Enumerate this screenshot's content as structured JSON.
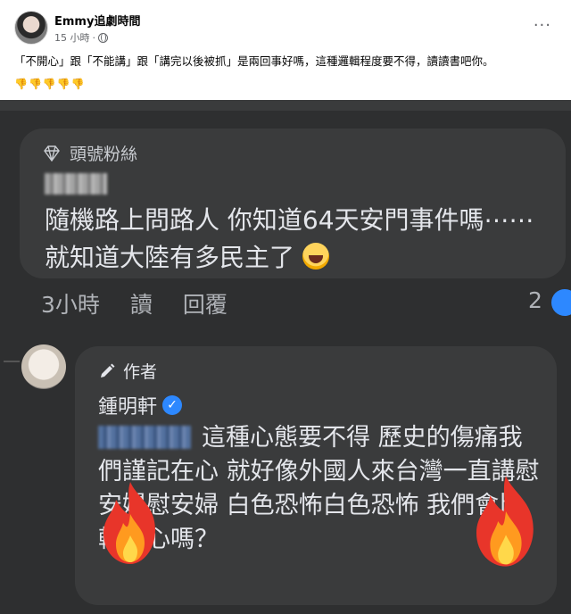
{
  "post": {
    "author": "Emmy追劇時間",
    "time": "15 小時",
    "separator": "·",
    "text": "「不開心」跟「不能講」跟「講完以後被抓」是兩回事好嗎，這種邏輯程度要不得，讀讀書吧你。",
    "emojis": "👎👎👎👎👎",
    "more": "···"
  },
  "screenshot": {
    "comment1": {
      "badge": "頭號粉絲",
      "text": "隨機路上問路人 你知道64天安門事件嗎⋯⋯ 就知道大陸有多民主了",
      "time": "3小時",
      "read": "讀",
      "reply": "回覆",
      "reaction_count": "2"
    },
    "comment2": {
      "badge": "作者",
      "name": "鍾明軒",
      "text": "這種心態要不得 歷史的傷痛我們謹記在心 就好像外國人來台灣一直講慰安婦慰安婦 白色恐怖白色恐怖 我們會比較開心嗎？"
    }
  },
  "colors": {
    "dark_bg": "#2e2f30",
    "bubble": "#3a3b3c",
    "text_light": "#e4e6eb",
    "muted": "#b0b3b8",
    "accent": "#2d88ff"
  },
  "icons": [
    "globe-icon",
    "more-icon",
    "diamond-icon",
    "laugh-icon",
    "like-icon",
    "pencil-icon",
    "verified-icon",
    "fire-icon"
  ]
}
